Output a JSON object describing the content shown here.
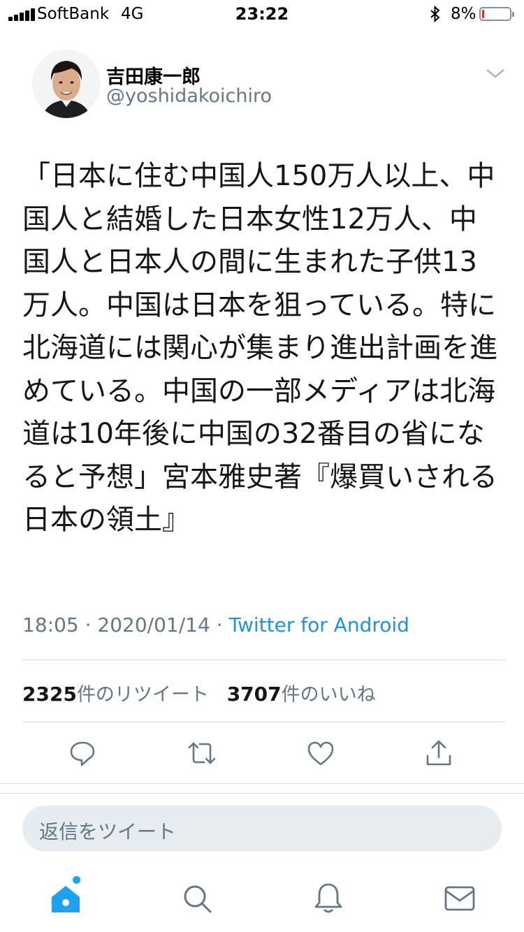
{
  "status_bar": {
    "carrier": "SoftBank",
    "network": "4G",
    "time": "23:22",
    "battery_percent": "8%",
    "battery_level": 0.08,
    "battery_color": "#e0302a"
  },
  "tweet": {
    "display_name": "吉田康一郎",
    "handle": "@yoshidakoichiro",
    "text": "「日本に住む中国人150万人以上、中国人と結婚した日本女性12万人、中国人と日本人の間に生まれた子供13万人。中国は日本を狙っている。特に北海道には関心が集まり進出計画を進めている。中国の一部メディアは北海道は10年後に中国の32番目の省になると予想」宮本雅史著『爆買いされる日本の領土』",
    "time": "18:05",
    "date": "2020/01/14",
    "source": "Twitter for Android",
    "separator": "·",
    "retweet_count": "2325",
    "retweet_label": "件のリツイート",
    "like_count": "3707",
    "like_label": "件のいいね"
  },
  "actions": [
    "reply-icon",
    "retweet-icon",
    "like-icon",
    "share-icon"
  ],
  "reply_box": {
    "placeholder": "返信をツイート"
  },
  "tab_bar": [
    "home-icon",
    "search-icon",
    "notifications-icon",
    "messages-icon"
  ],
  "colors": {
    "accent": "#1da1f2",
    "link": "#1b95e0",
    "secondary": "#657786",
    "reply_bg": "#e6ecf0"
  }
}
